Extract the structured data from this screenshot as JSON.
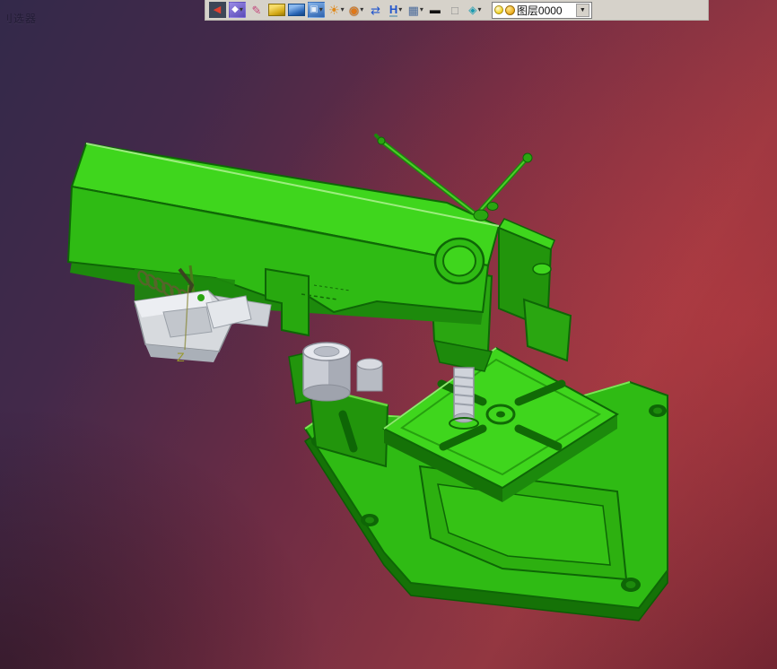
{
  "window": {
    "corner_text": "刂选器"
  },
  "toolbar": {
    "items": [
      {
        "name": "exit",
        "glyph": "◀",
        "arrow": ""
      },
      {
        "name": "render-library",
        "glyph": "◆",
        "arrow": "▾"
      },
      {
        "name": "sketch-pencil",
        "glyph": "✎",
        "arrow": ""
      },
      {
        "name": "yellow-solid",
        "glyph": "",
        "arrow": ""
      },
      {
        "name": "blue-solid",
        "glyph": "",
        "arrow": ""
      },
      {
        "name": "boolean-cube",
        "glyph": "▣",
        "arrow": "▾"
      },
      {
        "name": "pattern-wheel",
        "glyph": "☀",
        "arrow": "▾"
      },
      {
        "name": "zoom-search",
        "glyph": "◉",
        "arrow": "▾"
      },
      {
        "name": "swap-arrows",
        "glyph": "⇄",
        "arrow": ""
      },
      {
        "name": "h-dimension",
        "glyph": "H",
        "arrow": "▾"
      },
      {
        "name": "display-monitor",
        "glyph": "▦",
        "arrow": "▾"
      },
      {
        "name": "line-style",
        "glyph": "▬",
        "arrow": ""
      },
      {
        "name": "plane-square",
        "glyph": "□",
        "arrow": ""
      },
      {
        "name": "view-mode",
        "glyph": "◈",
        "arrow": "▾"
      }
    ],
    "layer_combo": {
      "value": "图层0000",
      "arrow": "▼"
    }
  },
  "viewport": {
    "axis_label": "Z",
    "colors": {
      "model_green_bright": "#3fd61d",
      "model_green_mid": "#2fbb14",
      "model_green_dark": "#157207",
      "model_edge": "#0e6606",
      "white_part": "#d7dade",
      "bg_top_left": "#33294a",
      "bg_right": "#a33a44",
      "bg_bottom": "#6e2330",
      "toolbar_bg": "#d6d2ca",
      "axis_label_color": "#99992e"
    }
  }
}
